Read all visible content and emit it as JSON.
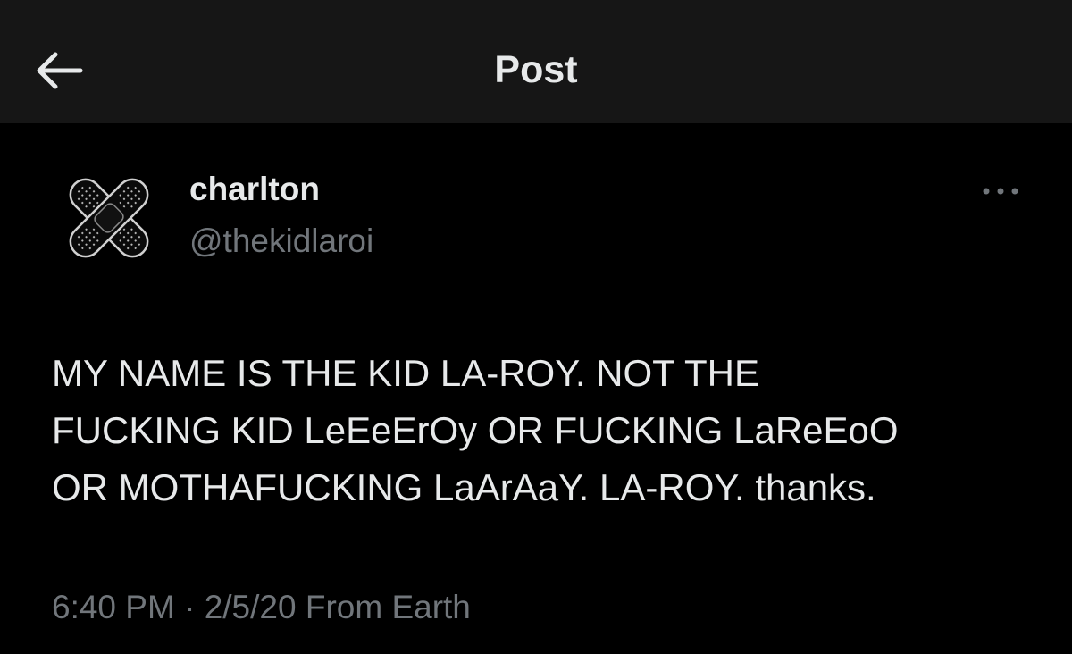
{
  "header": {
    "title": "Post",
    "back_icon": "arrow-left-icon"
  },
  "author": {
    "display_name": "charlton",
    "handle": "@thekidlaroi",
    "avatar_icon": "crossed-bandage-icon"
  },
  "post": {
    "text": "MY NAME IS THE KID LA-ROY. NOT THE\nFUCKING KID LeEeErOy OR FUCKING LaReEoO\nOR MOTHAFUCKING LaArAaY. LA-ROY. thanks.",
    "time": "6:40 PM",
    "separator": " · ",
    "date": "2/5/20",
    "source": " From Earth"
  },
  "more_icon": "more-options-icon",
  "colors": {
    "background": "#000000",
    "topbar": "#161616",
    "primary_text": "#e7e9ea",
    "secondary_text": "#71767b"
  }
}
